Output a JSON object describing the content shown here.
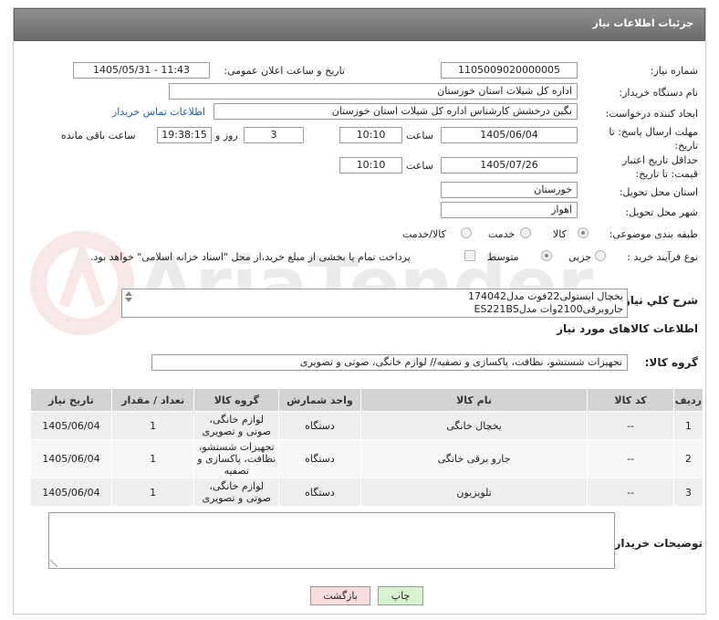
{
  "header": {
    "title": "جزئیات اطلاعات نیاز"
  },
  "fields": {
    "need_number_label": "شماره نیاز:",
    "need_number": "1105009020000005",
    "announce_label": "تاریخ و ساعت اعلان عمومی:",
    "announce_value": "1405/05/31 - 11:43",
    "buyer_org_label": "نام دستگاه خریدار:",
    "buyer_org": "اداره کل شیلات استان خوزستان",
    "creator_label": "ایجاد کننده درخواست:",
    "creator": "نگین درخشش کارشناس اداره کل شیلات استان خوزستان",
    "contact_link": "اطلاعات تماس خریدار",
    "reply_deadline_label": "مهلت ارسال پاسخ: تا تاریخ:",
    "reply_date": "1405/06/04",
    "time_label": "ساعت",
    "reply_time": "10:10",
    "days_value": "3",
    "days_label": "روز و",
    "remaining_time": "19:38:15",
    "remaining_label": "ساعت باقی مانده",
    "price_validity_label": "حداقل تاریخ اعتبار قیمت: تا تاریخ:",
    "validity_date": "1405/07/26",
    "validity_time": "10:10",
    "province_label": "استان محل تحویل:",
    "province": "خوزستان",
    "city_label": "شهر محل تحویل:",
    "city": "اهواز",
    "category_label": "طبقه بندی موضوعی:",
    "category_options": [
      "کالا",
      "خدمت",
      "کالا/خدمت"
    ],
    "process_label": "نوع فرآیند خرید :",
    "process_options": [
      "جزیی",
      "متوسط"
    ],
    "payment_note": "پرداخت تمام یا بخشی از مبلغ خرید،از محل \"اسناد خزانه اسلامی\" خواهد بود.",
    "description_label": "شرح کلي نياز:",
    "description_line1": "یخچال ایستولی22فوت مدل174042",
    "description_line2": "جاروبرقی2100وات مدلES221BS",
    "goods_info_title": "اطلاعات کالاهای مورد نیاز",
    "goods_group_label": "گروه کالا:",
    "goods_group": "تجهیزات شستشو، نظافت، پاکسازی و تصفیه// لوازم خانگی، صوتی و تصویری",
    "buyer_notes_label": "توضیحات خریدار:"
  },
  "table": {
    "headers": [
      "ردیف",
      "کد کالا",
      "نام کالا",
      "واحد شمارش",
      "گروه کالا",
      "تعداد / مقدار",
      "تاریخ نیاز"
    ],
    "rows": [
      [
        "1",
        "--",
        "یخچال خانگی",
        "دستگاه",
        "لوازم خانگی، صوتی و تصویری",
        "1",
        "1405/06/04"
      ],
      [
        "2",
        "--",
        "جارو برقی خانگی",
        "دستگاه",
        "تجهیزات شستشو، نظافت، پاکسازی و تصفیه",
        "1",
        "1405/06/04"
      ],
      [
        "3",
        "--",
        "تلویزیون",
        "دستگاه",
        "لوازم خانگی، صوتی و تصویری",
        "1",
        "1405/06/04"
      ]
    ]
  },
  "buttons": {
    "print": "چاپ",
    "back": "بازگشت"
  },
  "watermark": "AriaTender.net",
  "colors": {
    "header": "#7a7a7a",
    "link": "#1a5fb4",
    "print_btn": "#d9f2d0",
    "back_btn": "#f9dcdc"
  }
}
